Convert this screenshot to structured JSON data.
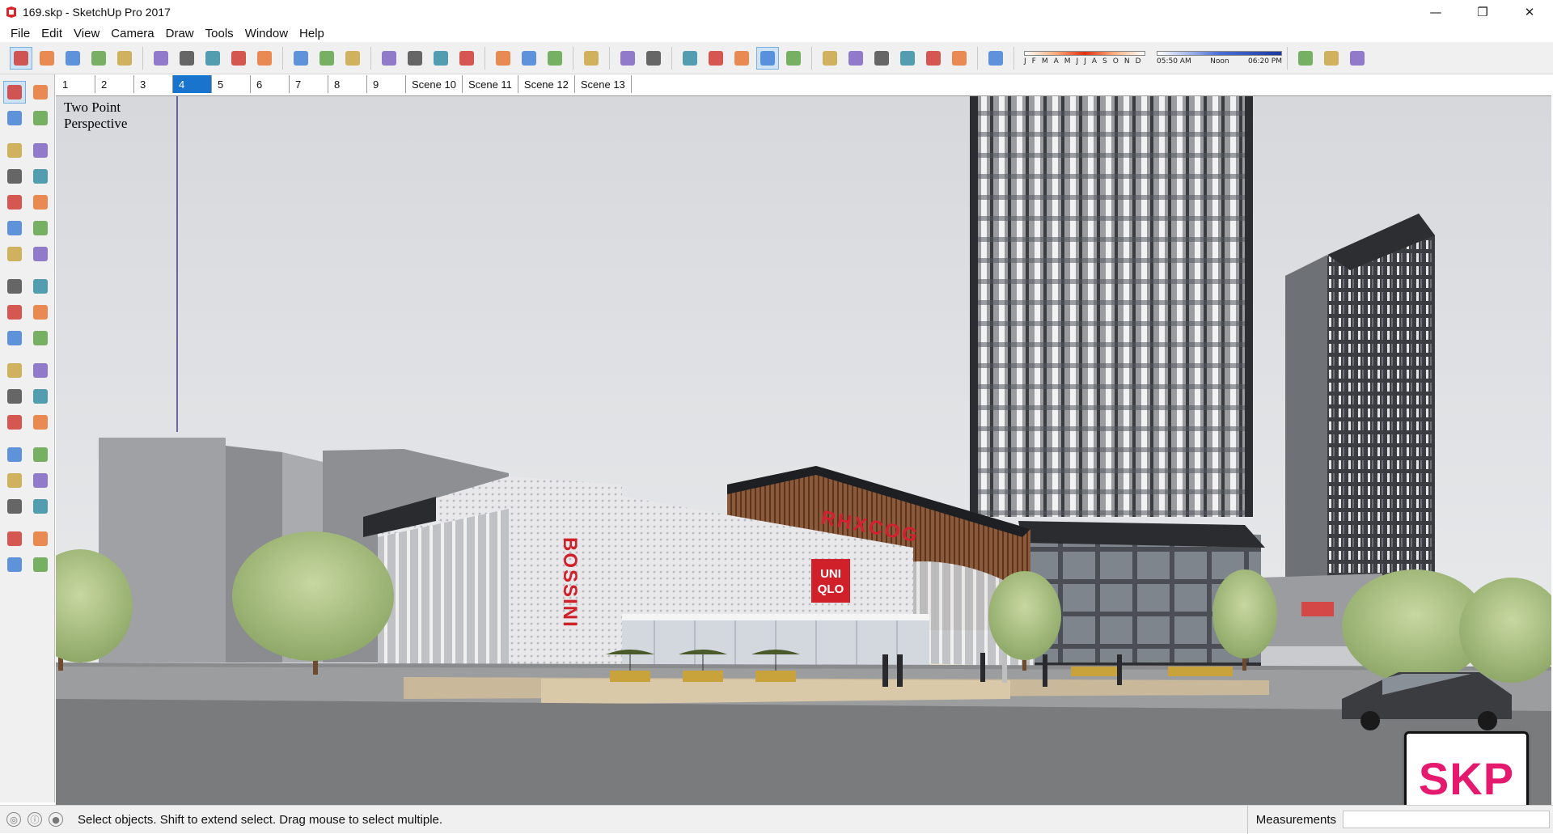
{
  "window": {
    "title": "169.skp - SketchUp Pro 2017",
    "controls": {
      "minimize": "—",
      "restore": "❐",
      "close": "✕"
    }
  },
  "menu": [
    "File",
    "Edit",
    "View",
    "Camera",
    "Draw",
    "Tools",
    "Window",
    "Help"
  ],
  "toolbar": {
    "groups": [
      [
        "select-icon",
        "eraser-icon",
        "pencil-icon",
        "arc-icon",
        "rectangle-icon"
      ],
      [
        "push-pull-icon",
        "follow-me-icon",
        "move-icon",
        "rotate-icon",
        "scale-icon"
      ],
      [
        "tape-measure-icon",
        "text-icon",
        "paint-bucket-icon"
      ],
      [
        "orbit-icon",
        "pan-icon",
        "zoom-icon",
        "zoom-extents-icon"
      ],
      [
        "warehouse-icon",
        "extension-warehouse-icon",
        "layout-icon"
      ],
      [
        "ruby-icon"
      ],
      [
        "xray-icon",
        "back-edges-icon"
      ],
      [
        "wireframe-icon",
        "hidden-line-icon",
        "shaded-icon",
        "shaded-textures-icon",
        "monochrome-icon"
      ],
      [
        "iso-view-icon",
        "top-view-icon",
        "front-view-icon",
        "right-view-icon",
        "back-view-icon",
        "left-view-icon"
      ],
      [
        "shadow-toggle-icon"
      ]
    ],
    "shadow": {
      "months": [
        "J",
        "F",
        "M",
        "A",
        "M",
        "J",
        "J",
        "A",
        "S",
        "O",
        "N",
        "D"
      ],
      "times": [
        "05:50 AM",
        "Noon",
        "06:20 PM"
      ]
    },
    "tail_icons": [
      "section-plane-icon",
      "section-display-icon",
      "download-icon"
    ]
  },
  "scenes": [
    {
      "label": "1",
      "active": false
    },
    {
      "label": "2",
      "active": false
    },
    {
      "label": "3",
      "active": false
    },
    {
      "label": "4",
      "active": true
    },
    {
      "label": "5",
      "active": false
    },
    {
      "label": "6",
      "active": false
    },
    {
      "label": "7",
      "active": false
    },
    {
      "label": "8",
      "active": false
    },
    {
      "label": "9",
      "active": false
    },
    {
      "label": "Scene 10",
      "active": false
    },
    {
      "label": "Scene 11",
      "active": false
    },
    {
      "label": "Scene 12",
      "active": false
    },
    {
      "label": "Scene 13",
      "active": false
    }
  ],
  "palette": [
    [
      "select-tool-icon",
      "component-tool-icon"
    ],
    [
      "paint-tool-icon",
      "eraser-tool-icon"
    ],
    [
      "line-tool-icon",
      "freehand-tool-icon"
    ],
    [
      "rectangle-tool-icon",
      "rotated-rectangle-tool-icon"
    ],
    [
      "circle-tool-icon",
      "polygon-tool-icon"
    ],
    [
      "arc-tool-icon",
      "two-point-arc-tool-icon"
    ],
    [
      "three-point-arc-tool-icon",
      "pie-tool-icon"
    ],
    [
      "move-tool-icon",
      "push-pull-tool-icon"
    ],
    [
      "rotate-tool-icon",
      "follow-me-tool-icon"
    ],
    [
      "scale-tool-icon",
      "offset-tool-icon"
    ],
    [
      "tape-tool-icon",
      "dimension-tool-icon"
    ],
    [
      "protractor-tool-icon",
      "text-tool-icon"
    ],
    [
      "axes-tool-icon",
      "3d-text-tool-icon"
    ],
    [
      "orbit-tool-icon",
      "pan-tool-icon"
    ],
    [
      "zoom-tool-icon",
      "zoom-window-tool-icon"
    ],
    [
      "zoom-extents-tool-icon",
      "previous-view-tool-icon"
    ],
    [
      "position-camera-tool-icon",
      "look-around-tool-icon"
    ],
    [
      "walk-tool-icon",
      "section-tool-icon"
    ]
  ],
  "viewport": {
    "camera_label_line1": "Two Point",
    "camera_label_line2": "Perspective",
    "signs": {
      "bossini": "BOSSINI",
      "uniqlo_line1": "UNI",
      "uniqlo_line2": "QLO",
      "tower_sign": "RHXCOG"
    }
  },
  "status": {
    "message": "Select objects. Shift to extend select. Drag mouse to select multiple.",
    "measurements_label": "Measurements",
    "measurements_value": ""
  },
  "watermark": "SKP",
  "colors": {
    "accent_blue": "#1874cd",
    "sign_red": "#d0202a",
    "watermark_pink": "#e5196d"
  }
}
